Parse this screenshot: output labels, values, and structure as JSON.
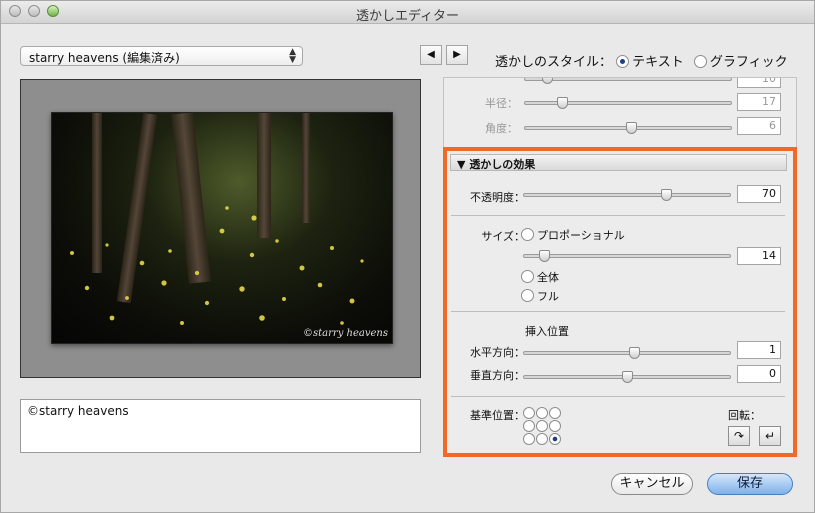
{
  "window": {
    "title": "透かしエディター"
  },
  "preset": {
    "value": "starry heavens (編集済み)"
  },
  "nav": {
    "prev": "◀",
    "next": "▶"
  },
  "style": {
    "label": "透かしのスタイル：",
    "text_option": "テキスト",
    "graphic_option": "グラフィック",
    "selected": "テキスト"
  },
  "preview": {
    "watermark": "©starry heavens"
  },
  "text_input": {
    "value": "©starry heavens"
  },
  "shadow_partial": {
    "row0_value": "10",
    "radius_label": "半径：",
    "radius_value": "17",
    "angle_label": "角度：",
    "angle_value": "6"
  },
  "effects": {
    "header": "透かしの効果",
    "opacity_label": "不透明度：",
    "opacity_value": "70",
    "size_label": "サイズ：",
    "size_proportional": "プロポーショナル",
    "size_value": "14",
    "size_fit": "全体",
    "size_fill": "フル",
    "inset_heading": "挿入位置",
    "horizontal_label": "水平方向：",
    "horizontal_value": "1",
    "vertical_label": "垂直方向：",
    "vertical_value": "0",
    "anchor_label": "基準位置：",
    "rotate_label": "回転：",
    "rotate_cw": "↷",
    "rotate_ccw": "↵"
  },
  "buttons": {
    "cancel": "キャンセル",
    "save": "保存"
  },
  "colors": {
    "highlight": "#f06a26",
    "primary_button": "#7fb1ea"
  }
}
